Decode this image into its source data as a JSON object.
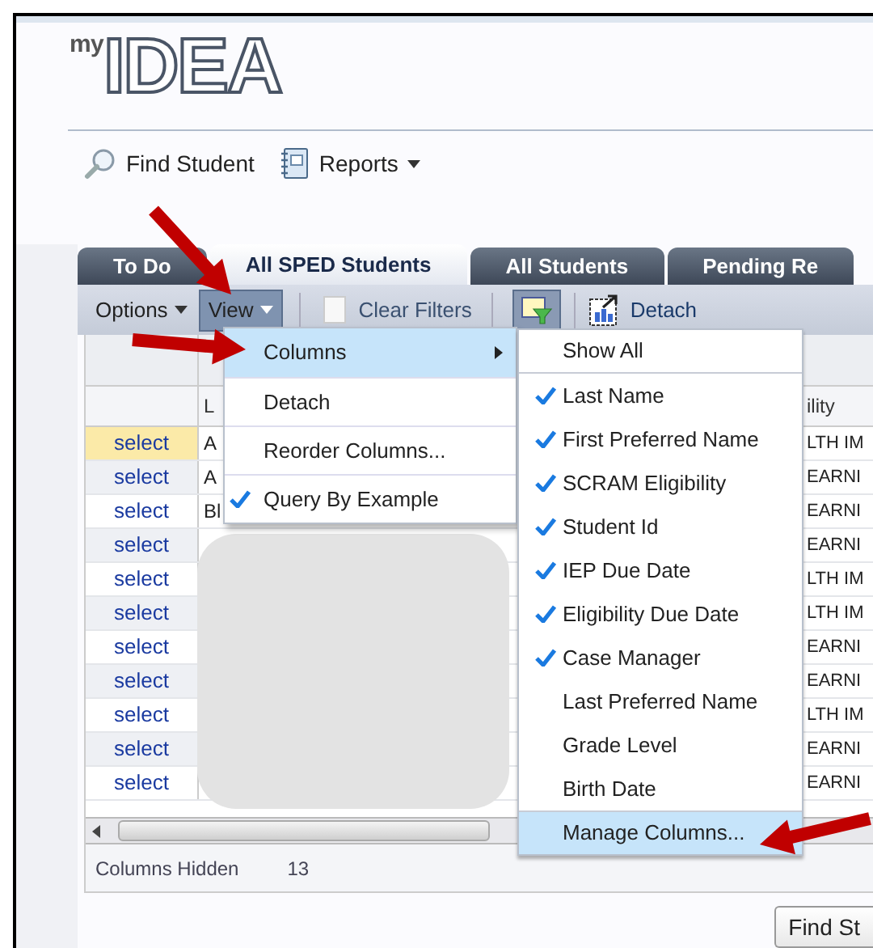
{
  "logo": {
    "small": "my",
    "large": "IDEA"
  },
  "nav": [
    {
      "label": "Find Student",
      "kind": "search"
    },
    {
      "label": "Reports",
      "kind": "reports"
    }
  ],
  "tabs": [
    {
      "label": "To Do",
      "selected": false
    },
    {
      "label": "All SPED Students",
      "selected": true
    },
    {
      "label": "All Students",
      "selected": false
    },
    {
      "label": "Pending Re",
      "selected": false
    }
  ],
  "toolbar": {
    "options": "Options",
    "view": {
      "label": "View",
      "selected": true
    },
    "clear_filters": "Clear Filters",
    "detach": "Detach"
  },
  "table": {
    "columns": [
      "L",
      "ility"
    ],
    "rows": [
      {
        "action": "select",
        "column_2": "A",
        "column_3": "LTH IM",
        "highlighted": true
      },
      {
        "action": "select",
        "column_2": "A",
        "column_3": "EARNI",
        "highlighted": false
      },
      {
        "action": "select",
        "column_2": "Bl",
        "column_3": "EARNI",
        "highlighted": false
      },
      {
        "action": "select",
        "column_3": "EARNI",
        "highlighted": false
      },
      {
        "action": "select",
        "column_3": "LTH IM",
        "highlighted": false
      },
      {
        "action": "select",
        "column_3": "LTH IM",
        "highlighted": false
      },
      {
        "action": "select",
        "column_3": "EARNI",
        "highlighted": false
      },
      {
        "action": "select",
        "column_3": "EARNI",
        "highlighted": false
      },
      {
        "action": "select",
        "column_3": "LTH IM",
        "highlighted": false
      },
      {
        "action": "select",
        "column_3": "EARNI",
        "highlighted": false
      },
      {
        "action": "select",
        "column_3": "EARNI",
        "highlighted": false
      }
    ]
  },
  "footer": {
    "label": "Columns Hidden",
    "value": "13"
  },
  "find_button": "Find St",
  "view_menu": [
    {
      "label": "Columns",
      "kind": "submenu",
      "selected": true,
      "checked": false
    },
    {
      "label": "Detach",
      "kind": "item",
      "selected": false,
      "checked": false
    },
    {
      "label": "Reorder Columns...",
      "kind": "item",
      "selected": false,
      "checked": false
    },
    {
      "label": "Query By Example",
      "kind": "item",
      "selected": false,
      "checked": true
    }
  ],
  "columns_menu": [
    {
      "label": "Show All",
      "kind": "action",
      "selected": false,
      "checked": false
    },
    {
      "label": "Last Name",
      "kind": "column",
      "selected": false,
      "checked": true
    },
    {
      "label": "First Preferred Name",
      "kind": "column",
      "selected": false,
      "checked": true
    },
    {
      "label": "SCRAM Eligibility",
      "kind": "column",
      "selected": false,
      "checked": true
    },
    {
      "label": "Student Id",
      "kind": "column",
      "selected": false,
      "checked": true
    },
    {
      "label": "IEP Due Date",
      "kind": "column",
      "selected": false,
      "checked": true
    },
    {
      "label": "Eligibility Due Date",
      "kind": "column",
      "selected": false,
      "checked": true
    },
    {
      "label": "Case Manager",
      "kind": "column",
      "selected": false,
      "checked": true
    },
    {
      "label": "Last Preferred Name",
      "kind": "column",
      "selected": false,
      "checked": false
    },
    {
      "label": "Grade Level",
      "kind": "column",
      "selected": false,
      "checked": false
    },
    {
      "label": "Birth Date",
      "kind": "column",
      "selected": false,
      "checked": false
    },
    {
      "label": "Manage Columns...",
      "kind": "action",
      "selected": true,
      "checked": false
    }
  ]
}
